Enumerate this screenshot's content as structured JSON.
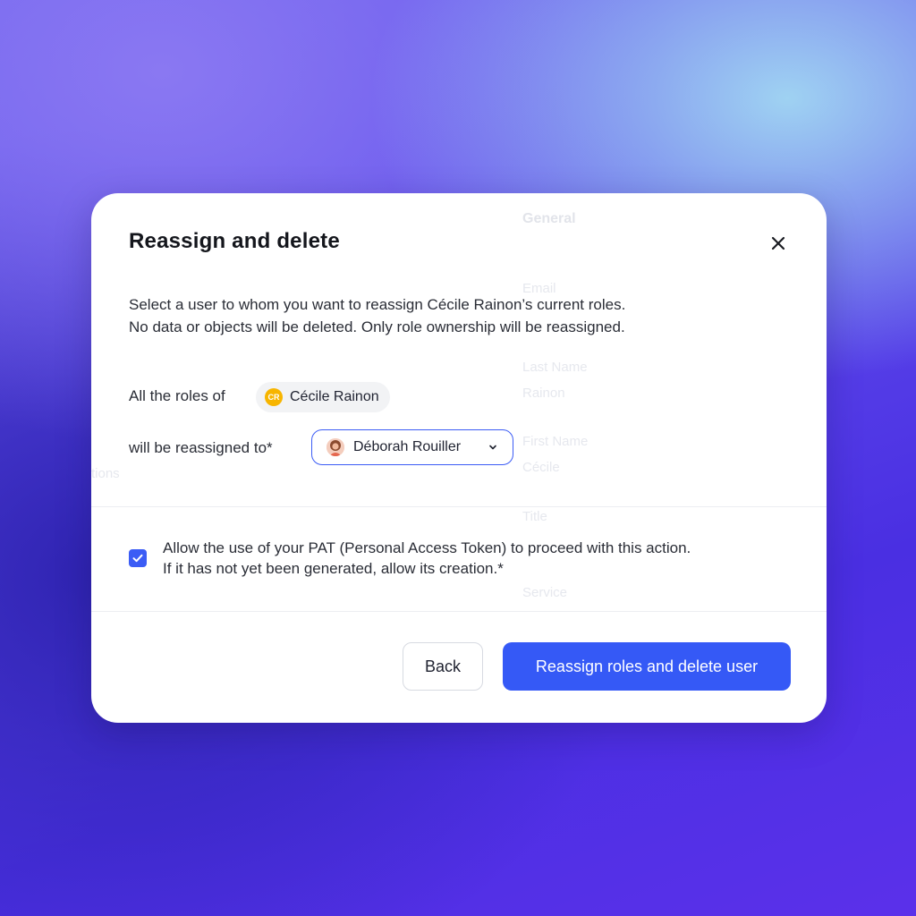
{
  "dialog": {
    "title": "Reassign and delete",
    "description_line1": "Select a user to whom you want to reassign Cécile Rainon’s current roles.",
    "description_line2": "No data or objects will be deleted. Only role ownership will be reassigned."
  },
  "source_user": {
    "label": "All the roles of",
    "initials": "CR",
    "name": "Cécile Rainon",
    "avatar_color": "#f7b500"
  },
  "target_user": {
    "label": "will be reassigned to*",
    "name": "Déborah Rouiller"
  },
  "consent": {
    "checked": true,
    "line1": "Allow the use of your PAT (Personal Access Token) to proceed with this action.",
    "line2": "If it has not yet been generated, allow its creation.*"
  },
  "footer": {
    "back_label": "Back",
    "confirm_label": "Reassign roles and delete user"
  },
  "background_page": {
    "tab_general": "General",
    "field_email": "Email",
    "field_last_name": "Last Name",
    "last_name_value": "Rainon",
    "field_first_name": "First Name",
    "first_name_value": "Cécile",
    "field_title": "Title",
    "field_service": "Service",
    "left_fragment": "tions"
  },
  "colors": {
    "accent": "#3559f6",
    "checkbox": "#3b5cf5",
    "select_border": "#3b5cf5"
  },
  "icons": {
    "close": "close-icon",
    "dropdown": "chevron-down-icon",
    "checkmark": "checkmark-icon"
  }
}
